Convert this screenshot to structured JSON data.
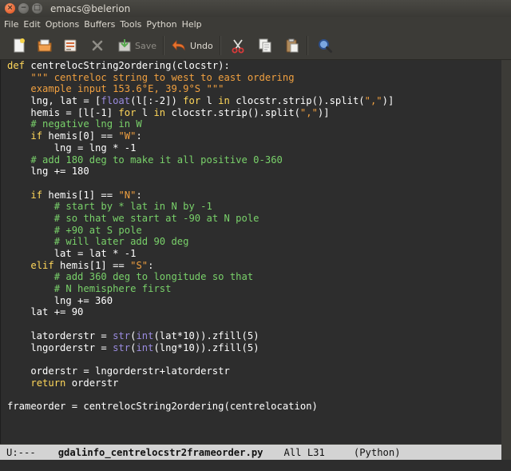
{
  "window": {
    "title": "emacs@belerion"
  },
  "menu": [
    "File",
    "Edit",
    "Options",
    "Buffers",
    "Tools",
    "Python",
    "Help"
  ],
  "toolbar": {
    "save_label": "Save",
    "undo_label": "Undo"
  },
  "code_lines": [
    [
      [
        "kw",
        "def "
      ],
      [
        "fn",
        "centrelocString2ordering(clocstr):"
      ]
    ],
    [
      [
        "",
        "    "
      ],
      [
        "str",
        "\"\"\" centreloc string to west to east ordering"
      ]
    ],
    [
      [
        "",
        "    "
      ],
      [
        "str",
        "example input 153.6°E, 39.9°S \"\"\""
      ]
    ],
    [
      [
        "",
        "    lng, lat = ["
      ],
      [
        "bi",
        "float"
      ],
      [
        "",
        "(l[:-2]) "
      ],
      [
        "kw",
        "for"
      ],
      [
        "",
        " l "
      ],
      [
        "kw",
        "in"
      ],
      [
        "",
        " clocstr.strip().split("
      ],
      [
        "str",
        "\",\""
      ],
      [
        "",
        ")]"
      ]
    ],
    [
      [
        "",
        "    hemis = [l[-1] "
      ],
      [
        "kw",
        "for"
      ],
      [
        "",
        " l "
      ],
      [
        "kw",
        "in"
      ],
      [
        "",
        " clocstr.strip().split("
      ],
      [
        "str",
        "\",\""
      ],
      [
        "",
        ")]"
      ]
    ],
    [
      [
        "",
        "    "
      ],
      [
        "com",
        "# negative lng in W"
      ]
    ],
    [
      [
        "",
        "    "
      ],
      [
        "kw",
        "if"
      ],
      [
        "",
        " hemis[0] == "
      ],
      [
        "str",
        "\"W\""
      ],
      [
        "",
        ":"
      ]
    ],
    [
      [
        "",
        "        lng = lng * -1"
      ]
    ],
    [
      [
        "",
        "    "
      ],
      [
        "com",
        "# add 180 deg to make it all positive 0-360"
      ]
    ],
    [
      [
        "",
        "    lng += 180"
      ]
    ],
    [
      [
        "",
        ""
      ]
    ],
    [
      [
        "",
        "    "
      ],
      [
        "kw",
        "if"
      ],
      [
        "",
        " hemis[1] == "
      ],
      [
        "str",
        "\"N\""
      ],
      [
        "",
        ":"
      ]
    ],
    [
      [
        "",
        "        "
      ],
      [
        "com",
        "# start by * lat in N by -1"
      ]
    ],
    [
      [
        "",
        "        "
      ],
      [
        "com",
        "# so that we start at -90 at N pole"
      ]
    ],
    [
      [
        "",
        "        "
      ],
      [
        "com",
        "# +90 at S pole"
      ]
    ],
    [
      [
        "",
        "        "
      ],
      [
        "com",
        "# will later add 90 deg"
      ]
    ],
    [
      [
        "",
        "        lat = lat * -1"
      ]
    ],
    [
      [
        "",
        "    "
      ],
      [
        "kw",
        "elif"
      ],
      [
        "",
        " hemis[1] == "
      ],
      [
        "str",
        "\"S\""
      ],
      [
        "",
        ":"
      ]
    ],
    [
      [
        "",
        "        "
      ],
      [
        "com",
        "# add 360 deg to longitude so that"
      ]
    ],
    [
      [
        "",
        "        "
      ],
      [
        "com",
        "# N hemisphere first"
      ]
    ],
    [
      [
        "",
        "        lng += 360"
      ]
    ],
    [
      [
        "",
        "    lat += 90"
      ]
    ],
    [
      [
        "",
        ""
      ]
    ],
    [
      [
        "",
        "    latorderstr = "
      ],
      [
        "bi",
        "str"
      ],
      [
        "",
        "("
      ],
      [
        "bi",
        "int"
      ],
      [
        "",
        "(lat*10)).zfill(5)"
      ]
    ],
    [
      [
        "",
        "    lngorderstr = "
      ],
      [
        "bi",
        "str"
      ],
      [
        "",
        "("
      ],
      [
        "bi",
        "int"
      ],
      [
        "",
        "(lng*10)).zfill(5)"
      ]
    ],
    [
      [
        "",
        ""
      ]
    ],
    [
      [
        "",
        "    orderstr = lngorderstr+latorderstr"
      ]
    ],
    [
      [
        "",
        "    "
      ],
      [
        "kw",
        "return"
      ],
      [
        "",
        " orderstr"
      ]
    ],
    [
      [
        "",
        ""
      ]
    ],
    [
      [
        "",
        "frameorder = centrelocString2ordering(centrelocation)"
      ]
    ]
  ],
  "modeline": {
    "status": "U:---",
    "filename": "gdalinfo_centrelocstr2frameorder.py",
    "position": "All L31",
    "mode": "(Python)"
  }
}
